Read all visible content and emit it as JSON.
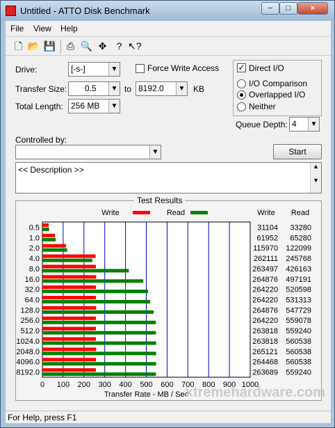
{
  "window": {
    "title": "Untitled - ATTO Disk Benchmark",
    "minimize": "−",
    "maximize": "□",
    "close": "×"
  },
  "menu": [
    "File",
    "View",
    "Help"
  ],
  "toolbar_icons": [
    "new-file-icon",
    "open-folder-icon",
    "save-icon",
    "print-icon",
    "print-preview-icon",
    "move-icon",
    "help-icon",
    "context-help-icon"
  ],
  "settings": {
    "drive_label": "Drive:",
    "drive_value": "[-s-]",
    "force_write_access": "Force Write Access",
    "direct_io": "Direct I/O",
    "transfer_size_label": "Transfer Size:",
    "transfer_from": "0.5",
    "to": "to",
    "transfer_to": "8192.0",
    "kb": "KB",
    "total_length_label": "Total Length:",
    "total_length": "256 MB",
    "io_comparison": "I/O Comparison",
    "overlapped_io": "Overlapped I/O",
    "neither": "Neither",
    "queue_depth_label": "Queue Depth:",
    "queue_depth": "4",
    "controlled_by_label": "Controlled by:",
    "start": "Start",
    "description": "<< Description >>"
  },
  "results_title": "Test Results",
  "legend": {
    "write": "Write",
    "read": "Read",
    "write_header": "Write",
    "read_header": "Read"
  },
  "status": "For Help, press F1",
  "watermark": "xtremehardware.com",
  "chart_data": {
    "type": "bar",
    "title": "Test Results",
    "xlabel": "Transfer Rate - MB / Sec",
    "xlim": [
      0,
      1000
    ],
    "xticks": [
      0,
      100,
      200,
      300,
      400,
      500,
      600,
      700,
      800,
      900,
      1000
    ],
    "colors": {
      "write": "#ff0000",
      "read": "#008000",
      "grid": "#0000c8"
    },
    "categories": [
      "0.5",
      "1.0",
      "2.0",
      "4.0",
      "8.0",
      "16.0",
      "32.0",
      "64.0",
      "128.0",
      "256.0",
      "512.0",
      "1024.0",
      "2048.0",
      "4096.0",
      "8192.0"
    ],
    "series": [
      {
        "name": "Write",
        "values": [
          31104,
          61952,
          115970,
          262111,
          263497,
          264876,
          264220,
          264220,
          264876,
          264220,
          263818,
          263818,
          265121,
          264468,
          263689
        ]
      },
      {
        "name": "Read",
        "values": [
          33280,
          65280,
          122099,
          245768,
          426163,
          497191,
          520598,
          531313,
          547729,
          559078,
          559240,
          560538,
          560538,
          560538,
          559240
        ]
      }
    ]
  }
}
